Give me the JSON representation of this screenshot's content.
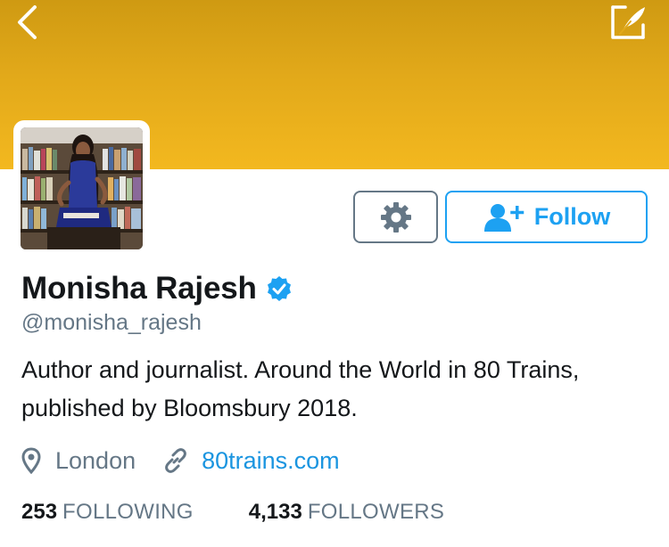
{
  "header": {
    "back_icon": "chevron-left-icon",
    "edit_icon": "compose-feather-icon",
    "banner_color": "#e2a91a"
  },
  "profile": {
    "avatar_alt": "",
    "display_name": "Monisha Rajesh",
    "verified": true,
    "handle": "@monisha_rajesh",
    "bio": "Author and journalist. Around the World in 80 Trains, published by Bloomsbury 2018.",
    "location": "London",
    "website": "80trains.com"
  },
  "actions": {
    "settings_icon": "gear-icon",
    "follow_label": "Follow",
    "follow_icon": "add-user-icon",
    "accent_color": "#1da1f2"
  },
  "stats": {
    "following_count": "253",
    "following_label": "FOLLOWING",
    "followers_count": "4,133",
    "followers_label": "FOLLOWERS"
  }
}
